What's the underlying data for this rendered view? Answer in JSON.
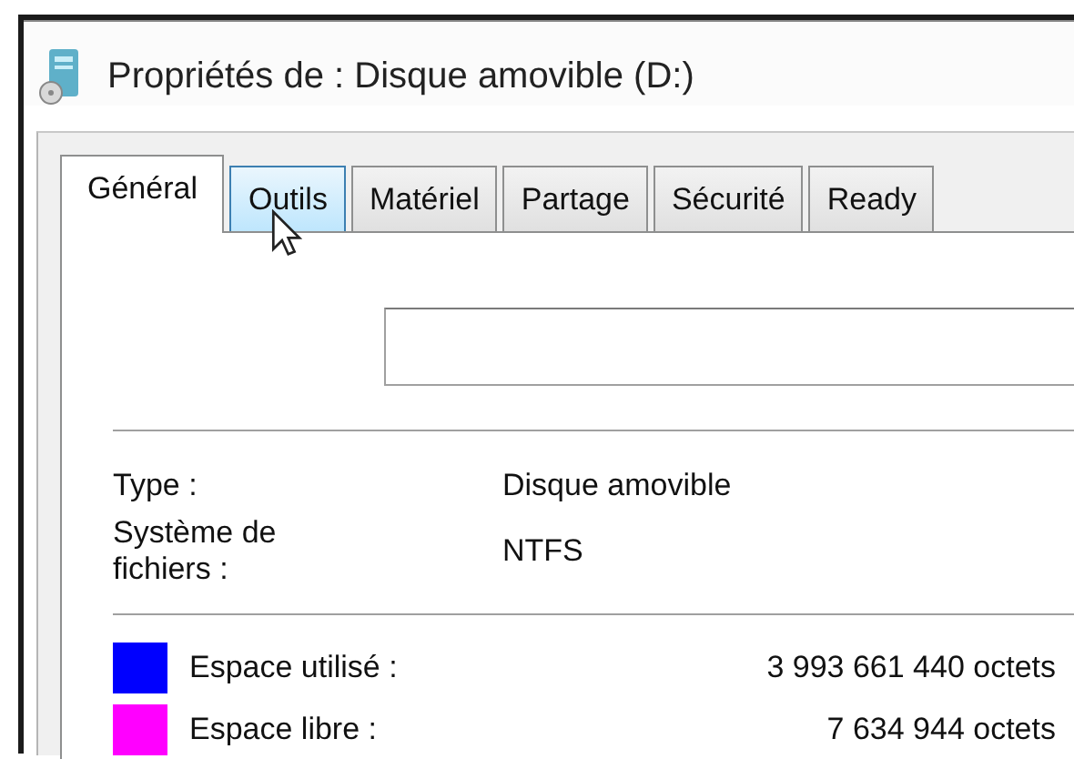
{
  "window": {
    "title": "Propriétés de : Disque amovible (D:)"
  },
  "tabs": [
    {
      "label": "Général",
      "selected": true,
      "hovered": false
    },
    {
      "label": "Outils",
      "selected": false,
      "hovered": true
    },
    {
      "label": "Matériel",
      "selected": false,
      "hovered": false
    },
    {
      "label": "Partage",
      "selected": false,
      "hovered": false
    },
    {
      "label": "Sécurité",
      "selected": false,
      "hovered": false
    },
    {
      "label": "Ready",
      "selected": false,
      "hovered": false
    }
  ],
  "info": [
    {
      "label": "Type :",
      "value": "Disque amovible"
    },
    {
      "label": "Système de fichiers :",
      "value": "NTFS"
    }
  ],
  "space": [
    {
      "label": "Espace utilisé :",
      "value": "3 993 661 440 octets",
      "color": "#0000ff"
    },
    {
      "label": "Espace libre :",
      "value": "7 634 944 octets",
      "color": "#ff00ff"
    }
  ]
}
